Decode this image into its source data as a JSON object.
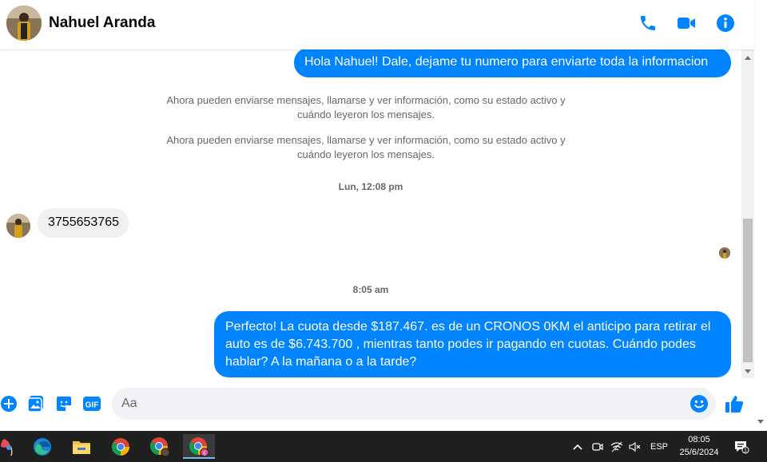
{
  "header": {
    "contact_name": "Nahuel Aranda",
    "icons": [
      "phone-icon",
      "video-camera-icon",
      "info-icon"
    ]
  },
  "messages": {
    "outgoing_1": "Hola Nahuel! Dale, dejame tu numero para enviarte toda la informacion",
    "system_1": "Ahora pueden enviarse mensajes, llamarse y ver información, como su estado activo y cuándo leyeron los mensajes.",
    "system_2": "Ahora pueden enviarse mensajes, llamarse y ver información, como su estado activo y cuándo leyeron los mensajes.",
    "timestamp_1": "Lun, 12:08 pm",
    "incoming_1": "3755653765",
    "timestamp_2": "8:05 am",
    "outgoing_2": "Perfecto! La cuota desde $187.467. es de un CRONOS 0KM el anticipo para retirar el auto es de $6.743.700 , mientras tanto podes ir pagando en cuotas. Cuándo podes hablar? A la mañana o a la tarde?"
  },
  "composer": {
    "placeholder": "Aa",
    "value": "",
    "icons": [
      "plus-icon",
      "image-icon",
      "sticker-icon",
      "gif-icon",
      "emoji-icon",
      "thumbs-up-icon"
    ],
    "gif_label": "GIF"
  },
  "taskbar": {
    "apps": [
      "weather-icon",
      "edge-icon",
      "file-explorer-icon",
      "chrome-icon",
      "chrome-profile-icon",
      "chrome-active-icon"
    ],
    "language": "ESP",
    "time": "08:05",
    "date": "25/6/2024",
    "notification_count": "1"
  },
  "colors": {
    "accent": "#0084ff",
    "incoming_bubble": "#f0f0f0",
    "taskbar": "#1f1f1f"
  }
}
